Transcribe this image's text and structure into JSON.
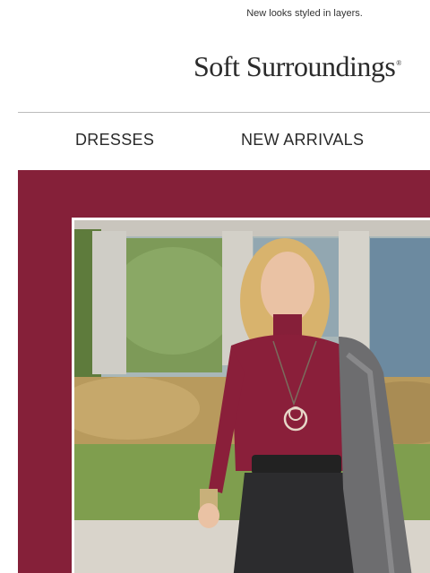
{
  "preheader": {
    "text": "New looks styled in layers."
  },
  "brand": {
    "name": "Soft Surroundings",
    "mark": "®"
  },
  "nav": {
    "items": [
      {
        "label": "DRESSES"
      },
      {
        "label": "NEW ARRIVALS"
      }
    ]
  },
  "hero": {
    "image_alt": "Woman wearing a burgundy turtleneck, pendant necklace, black skirt with tie belt, and grey knit coat draped over her shoulder",
    "colors": {
      "frame": "#852039"
    }
  }
}
